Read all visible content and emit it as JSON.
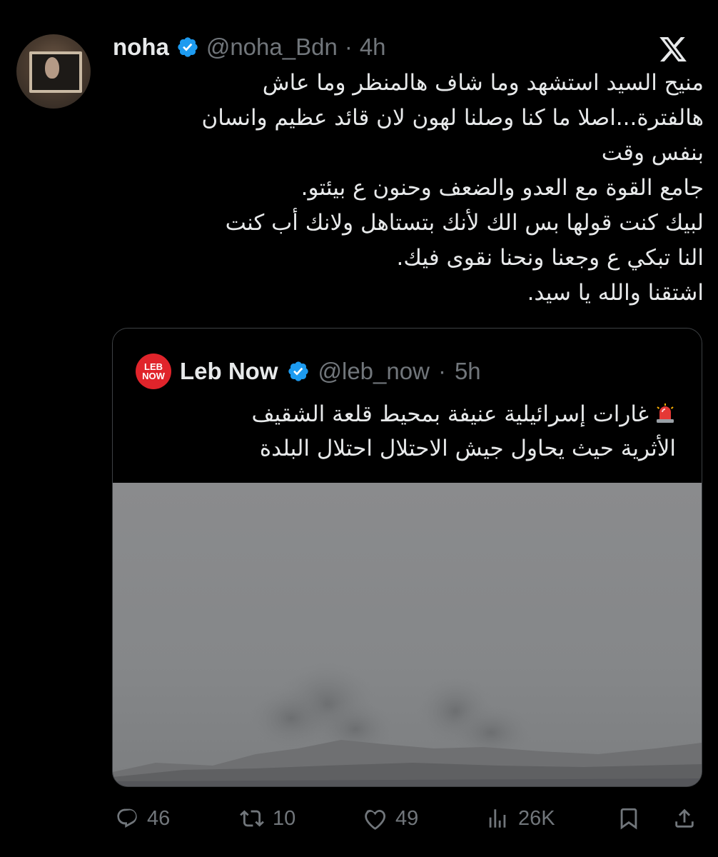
{
  "tweet": {
    "display_name": "noha",
    "handle": "@noha_Bdn",
    "separator": "·",
    "time": "4h",
    "lines": [
      "منيح السيد استشهد وما شاف هالمنظر وما عاش",
      "هالفترة...اصلا ما كنا وصلنا لهون لان قائد عظيم وانسان",
      "بنفس وقت",
      "جامع القوة مع العدو والضعف وحنون ع بيئتو.",
      "لبيك  كنت قولها بس الك لأنك بتستاهل ولانك أب كنت",
      "النا تبكي ع وجعنا ونحنا نقوى فيك.",
      "اشتقنا والله يا سيد."
    ]
  },
  "quote": {
    "avatar_text_top": "LEB",
    "avatar_text_bottom": "NOW",
    "display_name": "Leb Now",
    "handle": "@leb_now",
    "separator": "·",
    "time": "5h",
    "lines": [
      "غارات إسرائيلية عنيفة بمحيط قلعة الشقيف",
      "الأثرية حيث يحاول جيش الاحتلال احتلال البلدة"
    ]
  },
  "actions": {
    "replies": "46",
    "reposts": "10",
    "likes": "49",
    "views": "26K"
  },
  "icons": {
    "verified": "verified-badge-icon",
    "platform": "x-logo-icon",
    "siren": "siren-icon",
    "reply": "reply-icon",
    "repost": "repost-icon",
    "like": "like-icon",
    "views": "views-icon",
    "bookmark": "bookmark-icon",
    "share": "share-icon"
  },
  "colors": {
    "background": "#000000",
    "text": "#e7e9ea",
    "muted": "#71767b",
    "verified": "#1d9bf0",
    "leb_now_red": "#e0242b"
  }
}
